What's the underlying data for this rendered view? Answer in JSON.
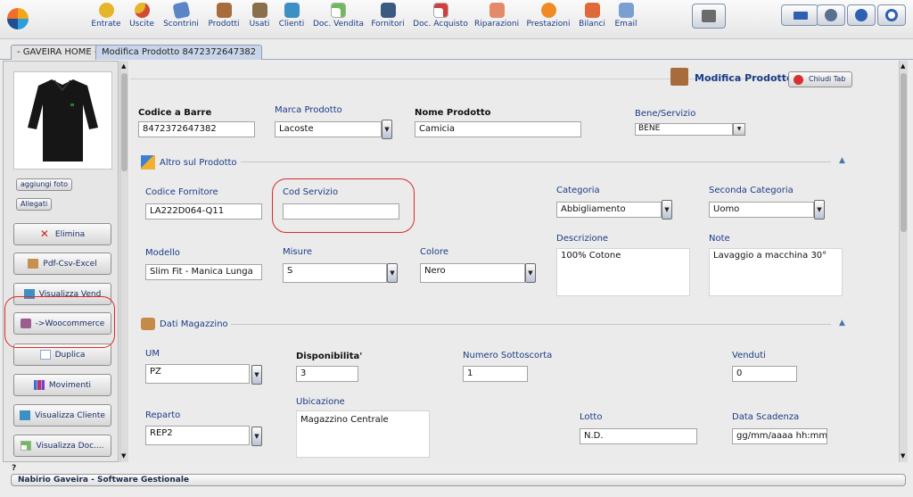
{
  "toolbar": {
    "items": [
      {
        "label": "Entrate",
        "icon": "money-bag-icon",
        "color": "#e6b52a"
      },
      {
        "label": "Uscite",
        "icon": "money-out-icon",
        "color": "#d14b35"
      },
      {
        "label": "Scontrini",
        "icon": "receipt-icon",
        "color": "#5a86c8"
      },
      {
        "label": "Prodotti",
        "icon": "boxes-icon",
        "color": "#a86b3c"
      },
      {
        "label": "Usati",
        "icon": "used-box-icon",
        "color": "#8a6f4d"
      },
      {
        "label": "Clienti",
        "icon": "customer-icon",
        "color": "#3e8fc3"
      },
      {
        "label": "Doc. Vendita",
        "icon": "sale-document-icon",
        "color": "#6dbb5a"
      },
      {
        "label": "Fornitori",
        "icon": "supplier-icon",
        "color": "#3b5a80"
      },
      {
        "label": "Doc. Acquisto",
        "icon": "purchase-document-icon",
        "color": "#d23d3d"
      },
      {
        "label": "Riparazioni",
        "icon": "repair-icon",
        "color": "#e28a6a"
      },
      {
        "label": "Prestazioni",
        "icon": "service-icon",
        "color": "#f08a24"
      },
      {
        "label": "Bilanci",
        "icon": "balance-icon",
        "color": "#e0683a"
      },
      {
        "label": "Email",
        "icon": "email-icon",
        "color": "#7a9fd0"
      }
    ],
    "right": [
      "printer-icon",
      "keyboard-icon",
      "settings-icon",
      "minimize-icon",
      "power-icon"
    ]
  },
  "tabs": [
    {
      "label": "- GAVEIRA HOME -"
    },
    {
      "label": "Modifica Prodotto 8472372647382"
    }
  ],
  "sidebar": {
    "add_photo": "aggiungi foto",
    "attachments": "Allegati",
    "buttons": [
      {
        "label": "Elimina",
        "icon": "delete-icon",
        "color": "#d02020"
      },
      {
        "label": "Pdf-Csv-Excel",
        "icon": "export-icon",
        "color": "#c89050"
      },
      {
        "label": "Visualizza Vend",
        "icon": "view-sales-icon",
        "color": "#3e8fc3"
      },
      {
        "label": "->Woocommerce",
        "icon": "woocommerce-icon",
        "color": "#9b5c8f"
      },
      {
        "label": "Duplica",
        "icon": "duplicate-icon",
        "color": "#a9c4e8"
      },
      {
        "label": "Movimenti",
        "icon": "movements-chart-icon",
        "color": "#c0306e"
      },
      {
        "label": "Visualizza Cliente",
        "icon": "view-customer-icon",
        "color": "#3e8fc3"
      },
      {
        "label": "Visualizza Doc....",
        "icon": "view-document-icon",
        "color": "#6dbb5a"
      }
    ]
  },
  "header": {
    "title": "Modifica Prodotto",
    "close_tab": "Chiudi Tab"
  },
  "form": {
    "barcode": {
      "label": "Codice a Barre",
      "value": "8472372647382"
    },
    "brand": {
      "label": "Marca Prodotto",
      "value": "Lacoste"
    },
    "name": {
      "label": "Nome Prodotto",
      "value": "Camicia"
    },
    "good_service": {
      "label": "Bene/Servizio",
      "value": "BENE"
    },
    "section_other": "Altro sul Prodotto",
    "supplier_code": {
      "label": "Codice Fornitore",
      "value": "LA222D064-Q11"
    },
    "service_code": {
      "label": "Cod Servizio",
      "value": ""
    },
    "category": {
      "label": "Categoria",
      "value": "Abbigliamento"
    },
    "second_category": {
      "label": "Seconda Categoria",
      "value": "Uomo"
    },
    "model": {
      "label": "Modello",
      "value": "Slim Fit - Manica Lunga"
    },
    "size": {
      "label": "Misure",
      "value": "S"
    },
    "color": {
      "label": "Colore",
      "value": "Nero"
    },
    "description": {
      "label": "Descrizione",
      "value": "100% Cotone"
    },
    "notes": {
      "label": "Note",
      "value": "Lavaggio a macchina 30°"
    },
    "section_stock": "Dati Magazzino",
    "unit": {
      "label": "UM",
      "value": "PZ"
    },
    "availability": {
      "label": "Disponibilita'",
      "value": "3"
    },
    "min_stock": {
      "label": "Numero Sottoscorta",
      "value": "1"
    },
    "sold": {
      "label": "Venduti",
      "value": "0"
    },
    "location": {
      "label": "Ubicazione",
      "value": "Magazzino Centrale"
    },
    "department": {
      "label": "Reparto",
      "value": "REP2"
    },
    "lot": {
      "label": "Lotto",
      "value": "N.D."
    },
    "expiry": {
      "label": "Data Scadenza",
      "value": "gg/mm/aaaa hh:mm"
    }
  },
  "status": {
    "question": "?",
    "footer": "Nabirio Gaveira - Software Gestionale"
  }
}
